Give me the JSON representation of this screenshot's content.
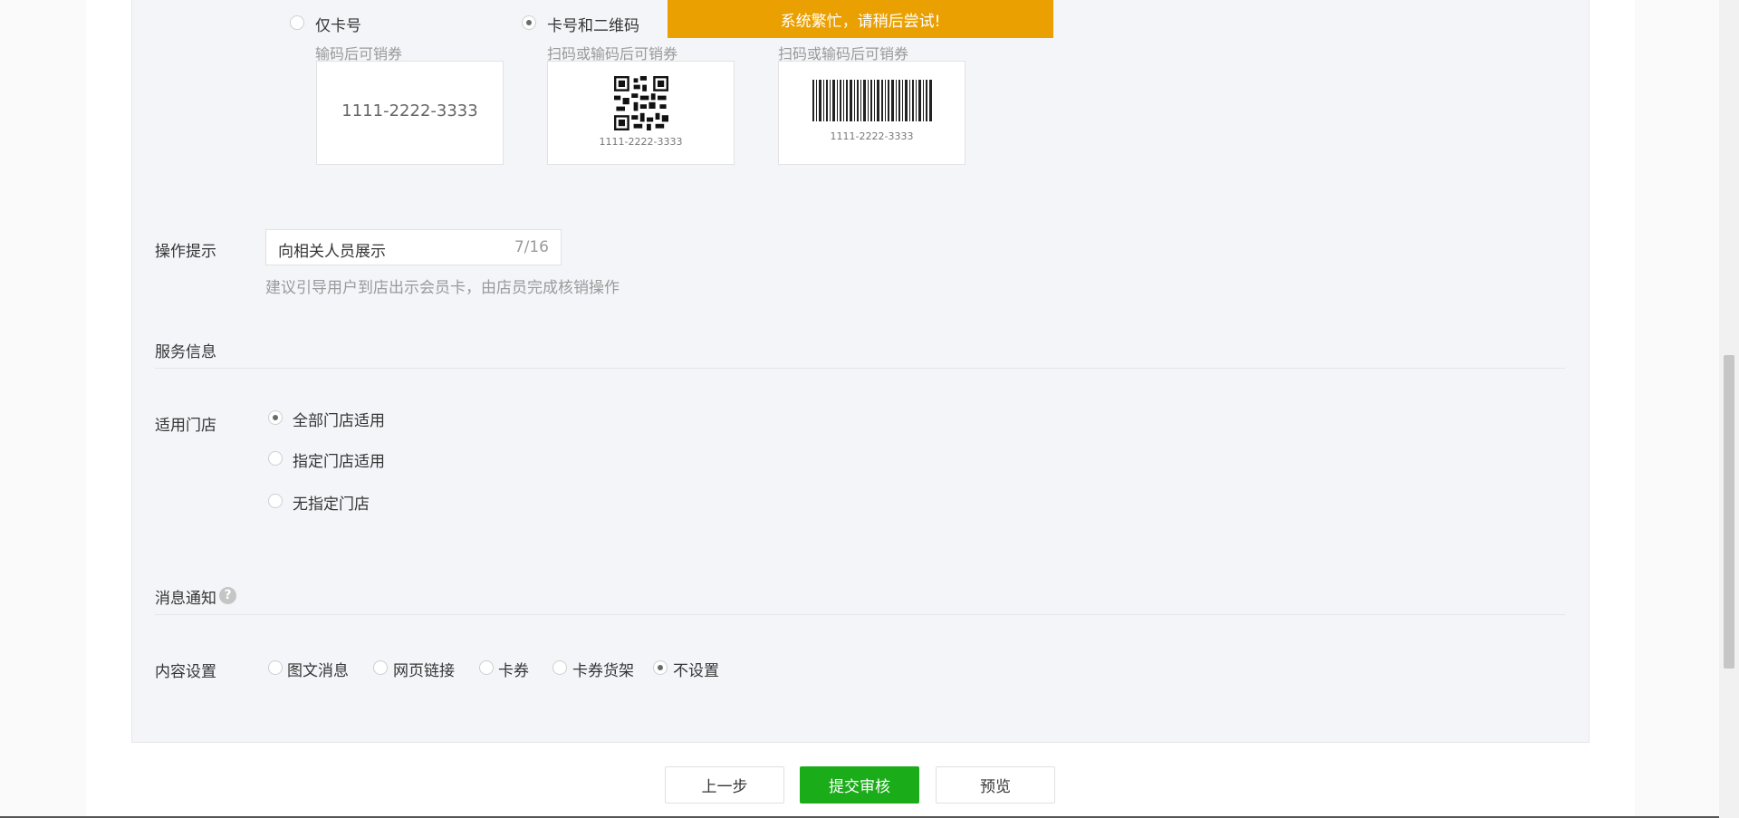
{
  "toast": {
    "text": "系统繁忙，请稍后尝试!"
  },
  "code_type": {
    "options": [
      {
        "label": "仅卡号",
        "hint": "输码后可销券",
        "preview_text": "1111-2222-3333",
        "checked": false
      },
      {
        "label": "卡号和二维码",
        "hint": "扫码或输码后可销券",
        "preview_text": "1111-2222-3333",
        "checked": true
      },
      {
        "label": "",
        "hint": "扫码或输码后可销券",
        "preview_text": "1111-2222-3333",
        "checked": false
      }
    ]
  },
  "operation_tip": {
    "label": "操作提示",
    "value": "向相关人员展示",
    "counter": "7/16",
    "help": "建议引导用户到店出示会员卡，由店员完成核销操作"
  },
  "service_info": {
    "title": "服务信息"
  },
  "stores": {
    "label": "适用门店",
    "options": [
      {
        "label": "全部门店适用",
        "checked": true
      },
      {
        "label": "指定门店适用",
        "checked": false
      },
      {
        "label": "无指定门店",
        "checked": false
      }
    ]
  },
  "notification": {
    "title": "消息通知",
    "help_icon": "?"
  },
  "content_setting": {
    "label": "内容设置",
    "options": [
      {
        "label": "图文消息",
        "checked": false
      },
      {
        "label": "网页链接",
        "checked": false
      },
      {
        "label": "卡券",
        "checked": false
      },
      {
        "label": "卡券货架",
        "checked": false
      },
      {
        "label": "不设置",
        "checked": true
      }
    ]
  },
  "buttons": {
    "prev": "上一步",
    "submit": "提交审核",
    "preview": "预览"
  },
  "colors": {
    "accent": "#1aad19",
    "toast": "#eaa000",
    "panel": "#f4f5f9"
  }
}
